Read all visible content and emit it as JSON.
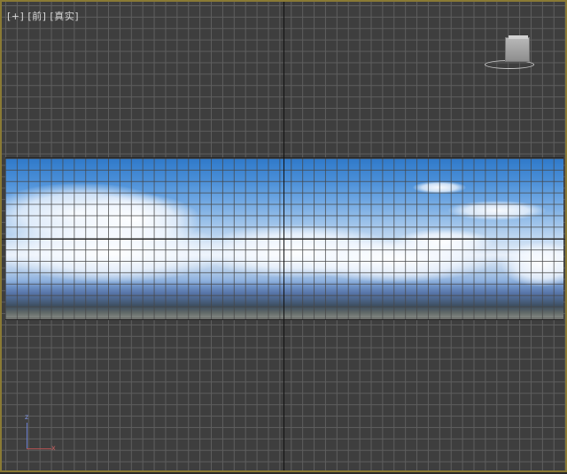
{
  "viewport": {
    "label_plus": "[+]",
    "label_view": "[前]",
    "label_shading": "[真实]"
  },
  "icons": {
    "viewcube": "viewcube-icon",
    "axis": "axis-tripod-icon"
  },
  "gizmo": {
    "z_label": "z",
    "x_label": "x"
  },
  "colors": {
    "viewport_border": "#8a7a34",
    "grid_line": "#5e5e5e",
    "background": "#3e3e3e"
  }
}
